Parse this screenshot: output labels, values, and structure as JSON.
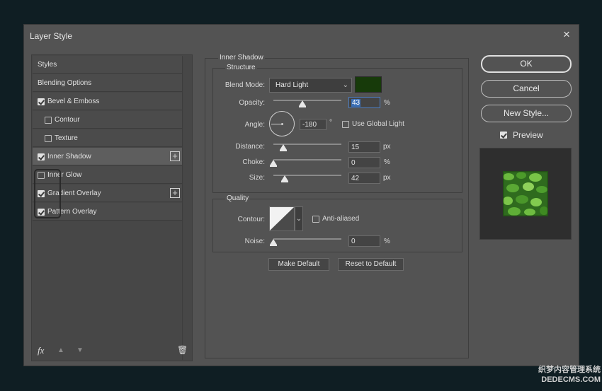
{
  "window": {
    "title": "Layer Style",
    "close_glyph": "×"
  },
  "sidebar": {
    "items": [
      {
        "label": "Styles",
        "has_checkbox": false,
        "checked": false,
        "has_plus": false,
        "indent": false,
        "selected": false
      },
      {
        "label": "Blending Options",
        "has_checkbox": false,
        "checked": false,
        "has_plus": false,
        "indent": false,
        "selected": false
      },
      {
        "label": "Bevel & Emboss",
        "has_checkbox": true,
        "checked": true,
        "has_plus": false,
        "indent": false,
        "selected": false
      },
      {
        "label": "Contour",
        "has_checkbox": true,
        "checked": false,
        "has_plus": false,
        "indent": true,
        "selected": false
      },
      {
        "label": "Texture",
        "has_checkbox": true,
        "checked": false,
        "has_plus": false,
        "indent": true,
        "selected": false
      },
      {
        "label": "Inner Shadow",
        "has_checkbox": true,
        "checked": true,
        "has_plus": true,
        "indent": false,
        "selected": true
      },
      {
        "label": "Inner Glow",
        "has_checkbox": true,
        "checked": false,
        "has_plus": false,
        "indent": false,
        "selected": false
      },
      {
        "label": "Gradient Overlay",
        "has_checkbox": true,
        "checked": true,
        "has_plus": true,
        "indent": false,
        "selected": false
      },
      {
        "label": "Pattern Overlay",
        "has_checkbox": true,
        "checked": true,
        "has_plus": false,
        "indent": false,
        "selected": false
      }
    ],
    "footer": {
      "fx": "fx",
      "up": "▲",
      "down": "▼",
      "trash": "🗑"
    }
  },
  "inner_shadow": {
    "title": "Inner Shadow",
    "structure": {
      "title": "Structure",
      "blend_mode_label": "Blend Mode:",
      "blend_mode": "Hard Light",
      "swatch_color": "#173a0a",
      "opacity_label": "Opacity:",
      "opacity": "43",
      "opacity_level": 0.43,
      "angle_label": "Angle:",
      "angle": "-180",
      "degree": "°",
      "use_global_light": "Use Global Light",
      "distance_label": "Distance:",
      "distance": "15",
      "distance_level": 0.15,
      "choke_label": "Choke:",
      "choke": "0",
      "choke_level": 0.0,
      "size_label": "Size:",
      "size": "42",
      "size_level": 0.17,
      "px": "px",
      "pct": "%"
    },
    "quality": {
      "title": "Quality",
      "contour_label": "Contour:",
      "anti_aliased": "Anti-aliased",
      "noise_label": "Noise:",
      "noise": "0",
      "noise_level": 0.0
    },
    "make_default": "Make Default",
    "reset_default": "Reset to Default"
  },
  "actions": {
    "ok": "OK",
    "cancel": "Cancel",
    "new_style": "New Style...",
    "preview": "Preview",
    "preview_checked": true
  },
  "watermark": {
    "line1": "织梦内容管理系统",
    "line2": "DEDECMS.COM"
  }
}
